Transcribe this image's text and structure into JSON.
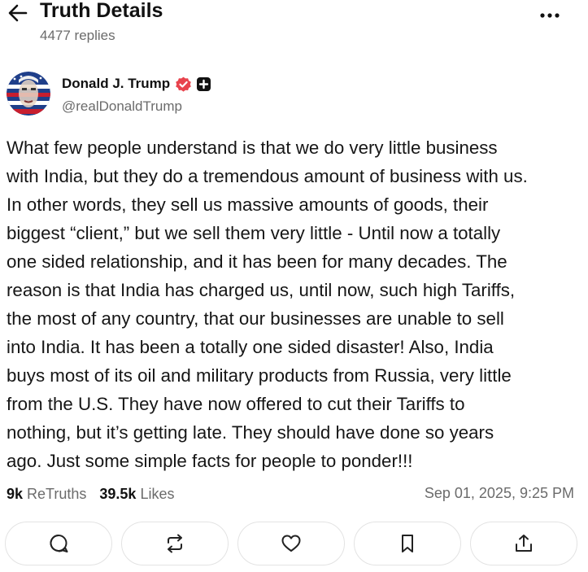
{
  "header": {
    "title": "Truth Details",
    "replies": "4477 replies",
    "back_icon": "arrow-left-icon",
    "more_icon": "more-horizontal-icon"
  },
  "author": {
    "name": "Donald J. Trump",
    "handle": "@realDonaldTrump",
    "verified_color": "#e8434d",
    "badges": [
      "verified-badge-icon",
      "plus-badge-icon"
    ]
  },
  "post": {
    "lines": [
      "What few people understand is that we do very little business",
      "with India, but they do a tremendous amount of business with us.",
      "In other words, they sell us massive amounts of goods, their",
      "biggest “client,” but we sell them very little - Until now a totally",
      "one sided relationship, and it has been for many decades. The",
      "reason is that India has charged us, until now, such high Tariffs,",
      "the most of any country, that our businesses are unable to sell",
      "into India. It has been a totally one sided disaster! Also, India",
      "buys most of its oil and military products from Russia, very little",
      "from the U.S. They have now offered to cut their Tariffs to",
      "nothing, but it’s getting late. They should have done so years",
      "ago. Just some simple facts for people to ponder!!!"
    ]
  },
  "stats": {
    "retruths_count": "9k",
    "retruths_label": "ReTruths",
    "likes_count": "39.5k",
    "likes_label": "Likes",
    "date": "Sep 01, 2025, 9:25 PM"
  },
  "actions": [
    {
      "name": "reply",
      "icon": "reply-bubble-icon"
    },
    {
      "name": "retruth",
      "icon": "retruth-arrows-icon"
    },
    {
      "name": "like",
      "icon": "heart-icon"
    },
    {
      "name": "bookmark",
      "icon": "bookmark-icon"
    },
    {
      "name": "share",
      "icon": "share-upload-icon"
    }
  ]
}
